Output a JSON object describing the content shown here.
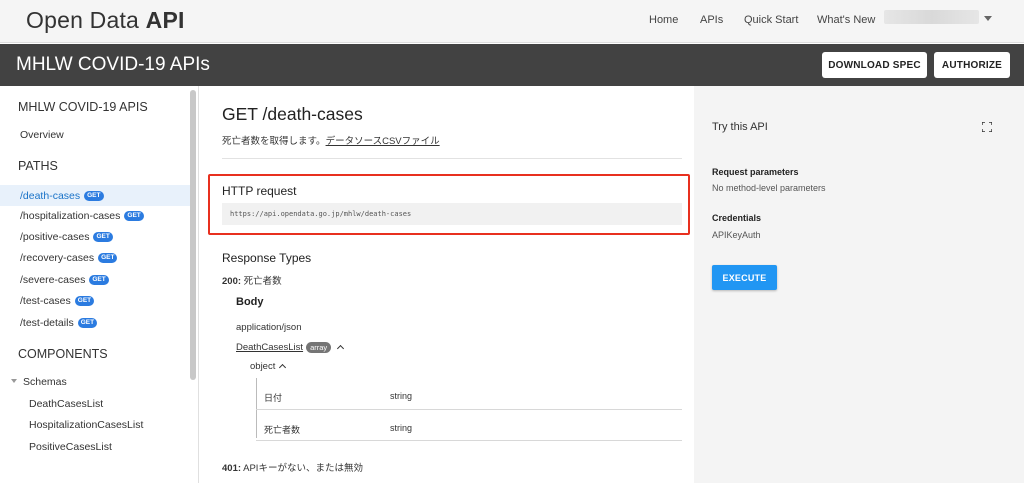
{
  "header": {
    "logo_prefix": "Open Data",
    "logo_bold": "API",
    "nav": [
      "Home",
      "APIs",
      "Quick Start",
      "What's New"
    ]
  },
  "titlebar": {
    "title": "MHLW COVID-19 APIs",
    "download_label": "DOWNLOAD SPEC",
    "authorize_label": "AUTHORIZE"
  },
  "sidebar": {
    "api_heading": "MHLW COVID-19 APIS",
    "overview": "Overview",
    "paths_heading": "PATHS",
    "get_badge": "GET",
    "paths": [
      "/death-cases",
      "/hospitalization-cases",
      "/positive-cases",
      "/recovery-cases",
      "/severe-cases",
      "/test-cases",
      "/test-details"
    ],
    "components_heading": "COMPONENTS",
    "schemas_label": "Schemas",
    "schemas": [
      "DeathCasesList",
      "HospitalizationCasesList",
      "PositiveCasesList"
    ]
  },
  "endpoint": {
    "title": "GET /death-cases",
    "desc_text": "死亡者数を取得します。",
    "desc_link": "データソースCSVファイル",
    "http_label": "HTTP request",
    "url": "https://api.opendata.go.jp/mhlw/death-cases",
    "response_types": "Response Types",
    "code_200": "200:",
    "code_200_text": " 死亡者数",
    "body_label": "Body",
    "content_type": "application/json",
    "schema_name": "DeathCasesList",
    "schema_badge": "array",
    "object_label": "object",
    "properties": [
      {
        "name": "日付",
        "type": "string"
      },
      {
        "name": "死亡者数",
        "type": "string"
      }
    ],
    "code_401": "401:",
    "code_401_text": " APIキーがない、または無効"
  },
  "try_panel": {
    "heading": "Try this API",
    "req_params_h": "Request parameters",
    "req_params_t": "No method-level parameters",
    "cred_h": "Credentials",
    "cred_t": "APIKeyAuth",
    "execute": "EXECUTE"
  }
}
